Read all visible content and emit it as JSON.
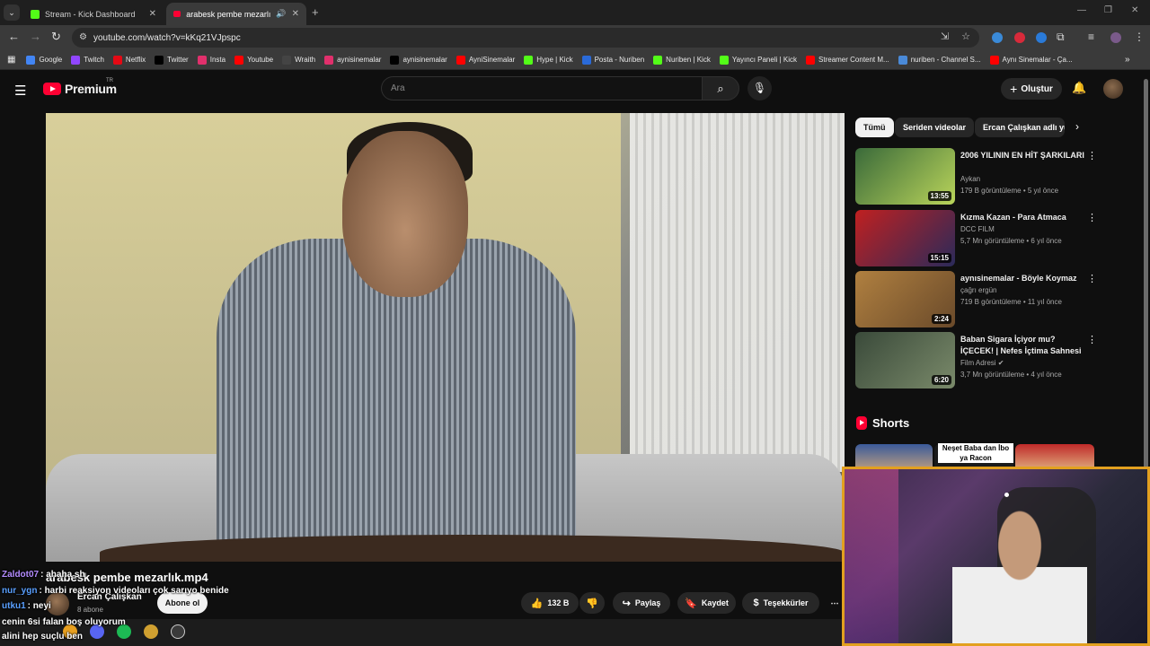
{
  "browser": {
    "tabs": [
      {
        "title": "Stream - Kick Dashboard",
        "icon": "kick-icon",
        "active": false
      },
      {
        "title": "arabesk pembe mezarlık.mp",
        "icon": "youtube-icon",
        "active": true
      }
    ],
    "url": "youtube.com/watch?v=kKq21VJpspc",
    "bookmarks": [
      {
        "label": "Google",
        "icon": "google-icon",
        "color": "#4285f4"
      },
      {
        "label": "Twitch",
        "icon": "twitch-icon",
        "color": "#9146ff"
      },
      {
        "label": "Netflix",
        "icon": "netflix-icon",
        "color": "#e50914"
      },
      {
        "label": "Twitter",
        "icon": "x-icon",
        "color": "#000000"
      },
      {
        "label": "Insta",
        "icon": "instagram-icon",
        "color": "#e1306c"
      },
      {
        "label": "Youtube",
        "icon": "youtube-icon",
        "color": "#ff0000"
      },
      {
        "label": "Wraith",
        "icon": "wraith-icon",
        "color": "#444444"
      },
      {
        "label": "aynisinemalar",
        "icon": "instagram-icon",
        "color": "#e1306c"
      },
      {
        "label": "aynisinemalar",
        "icon": "x-icon",
        "color": "#000000"
      },
      {
        "label": "AyniSinemalar",
        "icon": "youtube-icon",
        "color": "#ff0000"
      },
      {
        "label": "Hype | Kick",
        "icon": "kick-icon",
        "color": "#53fc18"
      },
      {
        "label": "Posta - Nuriben",
        "icon": "posta-icon",
        "color": "#2a6ad8"
      },
      {
        "label": "Nuriben | Kick",
        "icon": "kick-icon",
        "color": "#53fc18"
      },
      {
        "label": "Yayıncı Paneli | Kick",
        "icon": "kick-icon",
        "color": "#53fc18"
      },
      {
        "label": "Streamer Content M...",
        "icon": "youtube-icon",
        "color": "#ff0000"
      },
      {
        "label": "nuriben - Channel S...",
        "icon": "channel-icon",
        "color": "#4a8ad8"
      },
      {
        "label": "Aynı Sinemalar - Ça...",
        "icon": "youtube-icon",
        "color": "#ff0000"
      }
    ]
  },
  "yt": {
    "logo_text": "Premium",
    "region": "TR",
    "search_placeholder": "Ara",
    "create_label": "Oluştur",
    "video_title": "arabesk pembe mezarlık.mp4",
    "channel_name": "Ercan Çalışkan",
    "subscribers": "8 abone",
    "subscribe_label": "Abone ol",
    "likes": "132 B",
    "share_label": "Paylaş",
    "save_label": "Kaydet",
    "thanks_label": "Teşekkürler",
    "chips": [
      "Tümü",
      "Seriden videolar",
      "Ercan Çalışkan adlı yü"
    ],
    "recommendations": [
      {
        "title": "2006 YILININ EN HİT ŞARKILARI",
        "channel": "Aykan",
        "meta": "179 B görüntüleme • 5 yıl önce",
        "duration": "13:55",
        "verified": false,
        "colors": [
          "#3a6a3a",
          "#b9d45a"
        ]
      },
      {
        "title": "Kızma Kazan - Para Atmaca",
        "channel": "DCC FILM",
        "meta": "5,7 Mn görüntüleme • 6 yıl önce",
        "duration": "15:15",
        "verified": false,
        "colors": [
          "#c02020",
          "#2a2a5a"
        ]
      },
      {
        "title": "aynısinemalar - Böyle Koymaz",
        "channel": "çağrı ergün",
        "meta": "719 B görüntüleme • 11 yıl önce",
        "duration": "2:24",
        "verified": false,
        "colors": [
          "#b08040",
          "#6a4a2a"
        ]
      },
      {
        "title": "Baban Sigara İçiyor mu? İÇECEK! | Nefes İçtima Sahnesi",
        "channel": "Film Adresi",
        "meta": "3,7 Mn görüntüleme • 4 yıl önce",
        "duration": "6:20",
        "verified": true,
        "colors": [
          "#3a4a3a",
          "#7a8a6a"
        ]
      }
    ],
    "shorts_label": "Shorts",
    "short_caption": "Neşet Baba dan İbo ya Racon"
  },
  "chat": [
    {
      "user": "Zaldot07",
      "user_color": "#b48cff",
      "message": "ahaha sh"
    },
    {
      "user": "nur_ygn",
      "user_color": "#5aa0ff",
      "message": "harbi reaksiyon videoları çok sarıyo benide"
    },
    {
      "user": "utku1",
      "user_color": "#5aa0ff",
      "message": "neyi"
    },
    {
      "user": "",
      "user_color": "#ffffff",
      "message": "cenin 6si falan boş oluyorum"
    },
    {
      "user": "",
      "user_color": "#ffffff",
      "message": "alini hep suçlu ben"
    }
  ]
}
